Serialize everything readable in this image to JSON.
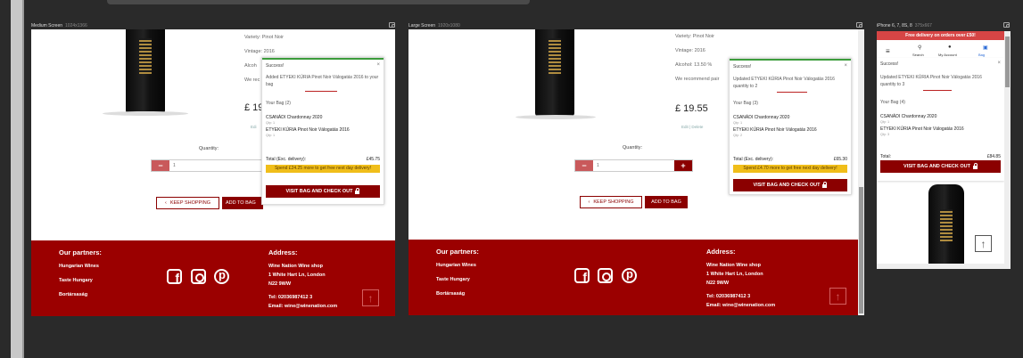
{
  "frames": {
    "medium": {
      "label": "Medium Screen",
      "dims": "1024x1366"
    },
    "large": {
      "label": "Large Screen",
      "dims": "1920x1080"
    },
    "mobile": {
      "label": "iPhone 6, 7, 8S, 8",
      "dims": "375x667"
    }
  },
  "product": {
    "variety": "Variety: Pinot Noir",
    "variety_short": "Variety: Pinot Noir",
    "vintage": "Vintage: 2016",
    "alcohol_cut": "Alcoh",
    "alcohol": "Alcohol: 13.50 %",
    "recommend_cut": "We rec",
    "recommend": "We recommend pair",
    "price_cut": "£ 19",
    "price": "£ 19.55",
    "edit_cut": "Edi",
    "edit_delete": "Edit | Delete"
  },
  "quantity": {
    "label": "Quantity:",
    "value": "1",
    "minus": "−",
    "plus": "+"
  },
  "buttons": {
    "keep_shopping": "KEEP SHOPPING",
    "add_to_bag_cut": "ADD TO BAG",
    "add_to_bag": "ADD TO BAG",
    "keep_icon": "‹"
  },
  "footer": {
    "partners_title": "Our partners:",
    "partners": [
      "Hungarian Wines",
      "Taste Hungary",
      "Bortársaság"
    ],
    "address_title": "Address:",
    "address_lines": [
      "Wine Nation Wine shop",
      "1 White Hart Ln, London",
      "N22 9WW"
    ],
    "tel": "Tel: 02036987412 3",
    "email": "Email: wine@winenation.com",
    "up_icon": "↑"
  },
  "popup_medium": {
    "title": "Success!",
    "close": "×",
    "message": "Added ETYEKI KÚRIA Pinot Noir Válogatás 2016 to your bag",
    "bag_title": "Your Bag (2)",
    "items": [
      {
        "name": "CSANÁDI Chardonnay 2020",
        "qty": "Qty: 1"
      },
      {
        "name": "ETYEKI KÚRIA Pinot Noir Válogatás 2016",
        "qty": "Qty: 1"
      }
    ],
    "total_label": "Total (Exc. delivery):",
    "total_value": "£45.75",
    "spend": "Spend £24.25 more to get free next day delivery!",
    "checkout": "VISIT BAG AND CHECK OUT"
  },
  "popup_large": {
    "title": "Success!",
    "close": "×",
    "message": "Updated ETYEKI KÚRIA Pinot Noir Válogatás 2016 quantity to 2",
    "bag_title": "Your Bag (3)",
    "items": [
      {
        "name": "CSANÁDI Chardonnay 2020",
        "qty": "Qty: 1"
      },
      {
        "name": "ETYEKI KÚRIA Pinot Noir Válogatás 2016",
        "qty": "Qty: 2"
      }
    ],
    "total_label": "Total (Exc. delivery):",
    "total_value": "£65.30",
    "spend": "Spend £4.70 more to get free next day delivery!",
    "checkout": "VISIT BAG AND CHECK OUT"
  },
  "popup_mobile": {
    "title": "Success!",
    "close": "×",
    "message": "Updated ETYEKI KÚRIA Pinot Noir Válogatás 2016 quantity to 3",
    "bag_title": "Your Bag (4)",
    "items": [
      {
        "name": "CSANÁDI Chardonnay 2020",
        "qty": "Qty: 1"
      },
      {
        "name": "ETYEKI KÚRIA Pinot Noir Válogatás 2016",
        "qty": "Qty: 3"
      }
    ],
    "total_label": "Total:",
    "total_value": "£84.85",
    "checkout": "VISIT BAG AND CHECK OUT"
  },
  "mobile": {
    "banner": "Free delivery on orders over £50!",
    "nav": [
      {
        "icon": "⚲",
        "label": "Search"
      },
      {
        "icon": "●",
        "label": "My Account"
      },
      {
        "icon": "▣",
        "label": "Bag"
      }
    ],
    "menu_icon": "≡",
    "up_icon": "↑"
  },
  "colors": {
    "brand": "#9b0000",
    "button": "#8b0000",
    "spend": "#f0be1a",
    "banner": "#d64545"
  }
}
